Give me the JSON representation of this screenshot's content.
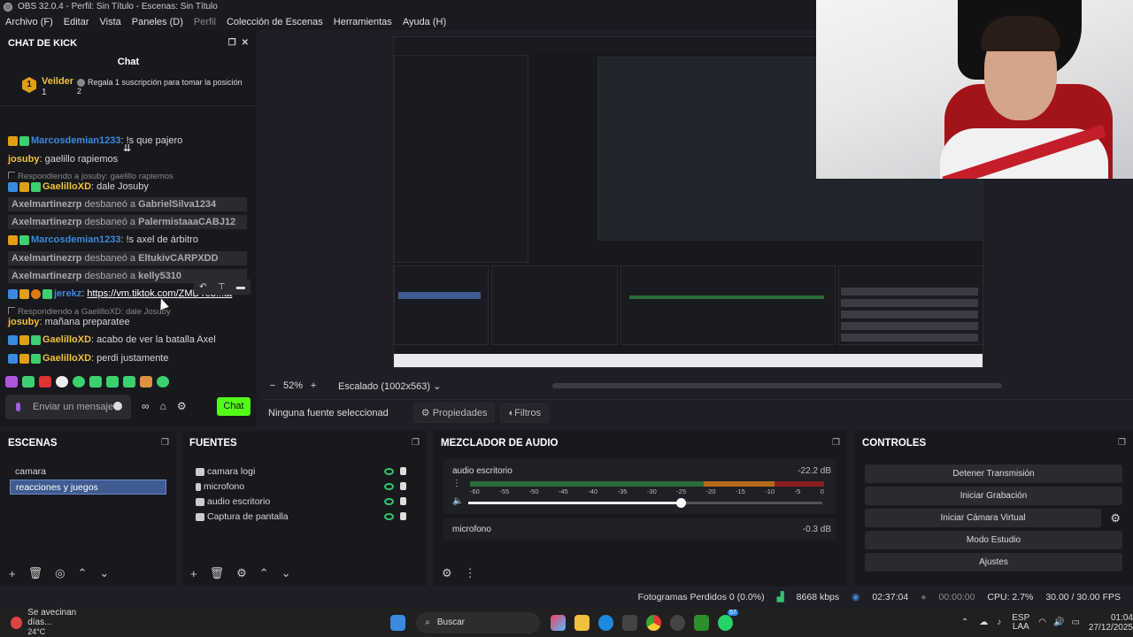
{
  "window": {
    "title": "OBS 32.0.4 - Perfil: Sin Título - Escenas: Sin Título"
  },
  "menu": [
    {
      "label": "Archivo (F)"
    },
    {
      "label": "Editar"
    },
    {
      "label": "Vista"
    },
    {
      "label": "Paneles (D)"
    },
    {
      "label": "Perfil"
    },
    {
      "label": "Colección de Escenas"
    },
    {
      "label": "Herramientas"
    },
    {
      "label": "Ayuda (H)"
    }
  ],
  "chat": {
    "dock_title": "CHAT DE KICK",
    "tab": "Chat",
    "pinned": {
      "badge": "1",
      "user": "Veilder",
      "count": "1",
      "text": "Regala 1 suscripción para tomar la posición",
      "position": "2"
    },
    "messages": [
      {
        "user": "Marcosdemian1233",
        "user_color": "#3a8ae0",
        "text": "!s que pajero"
      },
      {
        "user": "josuby",
        "user_color": "#f0c040",
        "text": "gaelillo rapiemos"
      },
      {
        "reply": "Respondiendo a josuby: gaelillo rapiemos"
      },
      {
        "user": "GaelilloXD",
        "user_color": "#f0c040",
        "text": "dale Josuby"
      },
      {
        "mod": "Axelmartinezrp",
        "action": "desbaneó a",
        "target": "GabrielSilva1234"
      },
      {
        "mod": "Axelmartinezrp",
        "action": "desbaneó a",
        "target": "PalermistaaaCABJ12"
      },
      {
        "user": "Marcosdemian1233",
        "user_color": "#3a8ae0",
        "text": "!s axel de árbitro"
      },
      {
        "mod": "Axelmartinezrp",
        "action": "desbaneó a",
        "target": "EltukivCARPXDD"
      },
      {
        "mod": "Axelmartinezrp",
        "action": "desbaneó a",
        "target": "kelly5310"
      },
      {
        "user": "jerekz",
        "user_color": "#3a8ae0",
        "link": "https://vm.tiktok.com/ZMDYeb...at"
      },
      {
        "reply": "Respondiendo a GaelilloXD: dale Josuby"
      },
      {
        "user": "josuby",
        "user_color": "#f0c040",
        "text": "mañana preparatee"
      },
      {
        "user": "GaelilloXD",
        "user_color": "#f0c040",
        "text": "acabo de ver la batalla Axel"
      },
      {
        "user": "GaelilloXD",
        "user_color": "#f0c040",
        "text": "perdi justamente"
      }
    ],
    "input_placeholder": "Enviar un mensaje",
    "send_label": "Chat"
  },
  "preview": {
    "zoom": "52%",
    "scale_label": "Escalado (1002x563)"
  },
  "context": {
    "no_source": "Ninguna fuente seleccionad",
    "props": "Propiedades",
    "filters": "Filtros"
  },
  "scenes": {
    "title": "ESCENAS",
    "items": [
      {
        "label": "camara",
        "selected": false
      },
      {
        "label": "reacciones y juegos",
        "selected": true
      }
    ]
  },
  "sources": {
    "title": "FUENTES",
    "items": [
      {
        "label": "camara logi"
      },
      {
        "label": "microfono"
      },
      {
        "label": "audio escritorio"
      },
      {
        "label": "Captura de pantalla"
      }
    ]
  },
  "mixer": {
    "title": "MEZCLADOR DE AUDIO",
    "channels": [
      {
        "name": "audio escritorio",
        "db": "-22.2 dB",
        "volume": 0.6
      },
      {
        "name": "microfono",
        "db": "-0.3 dB",
        "volume": 1
      }
    ],
    "ticks": [
      "-60",
      "-55",
      "-50",
      "-45",
      "-40",
      "-35",
      "-30",
      "-25",
      "-20",
      "-15",
      "-10",
      "-5",
      "0"
    ]
  },
  "controls": {
    "title": "CONTROLES",
    "buttons": [
      {
        "label": "Detener Transmisión"
      },
      {
        "label": "Iniciar Grabación"
      },
      {
        "label": "Iniciar Cámara Virtual"
      },
      {
        "label": "Modo Estudio"
      },
      {
        "label": "Ajustes"
      }
    ]
  },
  "status": {
    "dropped": "Fotogramas Perdidos 0 (0.0%)",
    "kbps": "8668 kbps",
    "stream_time": "02:37:04",
    "rec_time": "00:00:00",
    "cpu": "CPU: 2.7%",
    "fps": "30.00 / 30.00 FPS"
  },
  "taskbar": {
    "weather_title": "Se avecinan días...",
    "weather_temp": "24°C",
    "search": "Buscar",
    "lang1": "ESP",
    "lang2": "LAA",
    "time": "01:04",
    "date": "27/12/2025",
    "whatsapp_badge": "57"
  },
  "colors": {
    "accent_green": "#53fc18",
    "selection": "#3f5b91"
  }
}
